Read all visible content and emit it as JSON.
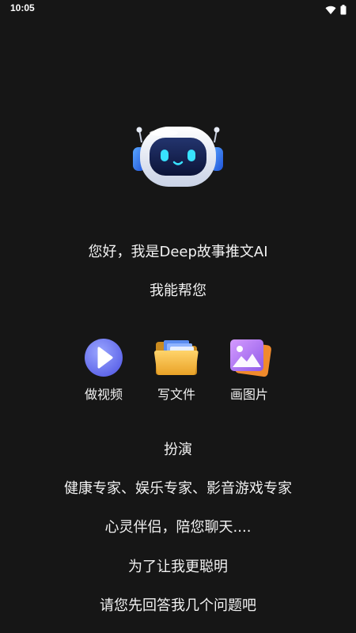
{
  "status_bar": {
    "time": "10:05",
    "icons": [
      "wifi-icon",
      "battery-icon"
    ]
  },
  "hero": {
    "icon": "robot-icon",
    "greeting": "您好，我是Deep故事推文AI",
    "subtitle": "我能帮您"
  },
  "features": [
    {
      "icon": "play-video-icon",
      "label": "做视频"
    },
    {
      "icon": "folder-files-icon",
      "label": "写文件"
    },
    {
      "icon": "image-gallery-icon",
      "label": "画图片"
    }
  ],
  "roles": {
    "title": "扮演",
    "experts": "健康专家、娱乐专家、影音游戏专家",
    "companion": "心灵伴侣，陪您聊天...."
  },
  "intro": {
    "line1": "为了让我更聪明",
    "line2": "请您先回答我几个问题吧"
  },
  "colors": {
    "background": "#161616",
    "text": "#f2f2f2",
    "play_accent": "#6f7ff5",
    "folder_accent": "#f4b53c",
    "image_accent": "#c58bf2"
  }
}
